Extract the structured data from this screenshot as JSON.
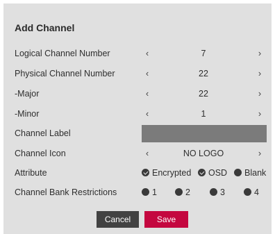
{
  "dialog": {
    "title": "Add Channel",
    "fields": {
      "logical": {
        "label": "Logical Channel Number",
        "value": "7"
      },
      "physical": {
        "label": "Physical Channel Number",
        "value": "22"
      },
      "major": {
        "label": "-Major",
        "value": "22"
      },
      "minor": {
        "label": "-Minor",
        "value": "1"
      },
      "channel_label": {
        "label": "Channel Label",
        "value": ""
      },
      "icon": {
        "label": "Channel Icon",
        "value": "NO LOGO"
      },
      "attribute": {
        "label": "Attribute",
        "options": [
          {
            "label": "Encrypted",
            "checked": true
          },
          {
            "label": "OSD",
            "checked": true
          },
          {
            "label": "Blank",
            "checked": false
          }
        ]
      },
      "bank": {
        "label": "Channel Bank Restrictions",
        "options": [
          {
            "label": "1"
          },
          {
            "label": "2"
          },
          {
            "label": "3"
          },
          {
            "label": "4"
          }
        ]
      }
    },
    "arrows": {
      "left": "‹",
      "right": "›"
    },
    "buttons": {
      "cancel": "Cancel",
      "save": "Save"
    },
    "colors": {
      "save_button": "#c4073f",
      "cancel_button": "#424242",
      "panel": "#e0e0e0",
      "label_input": "#7b7b7b"
    }
  }
}
